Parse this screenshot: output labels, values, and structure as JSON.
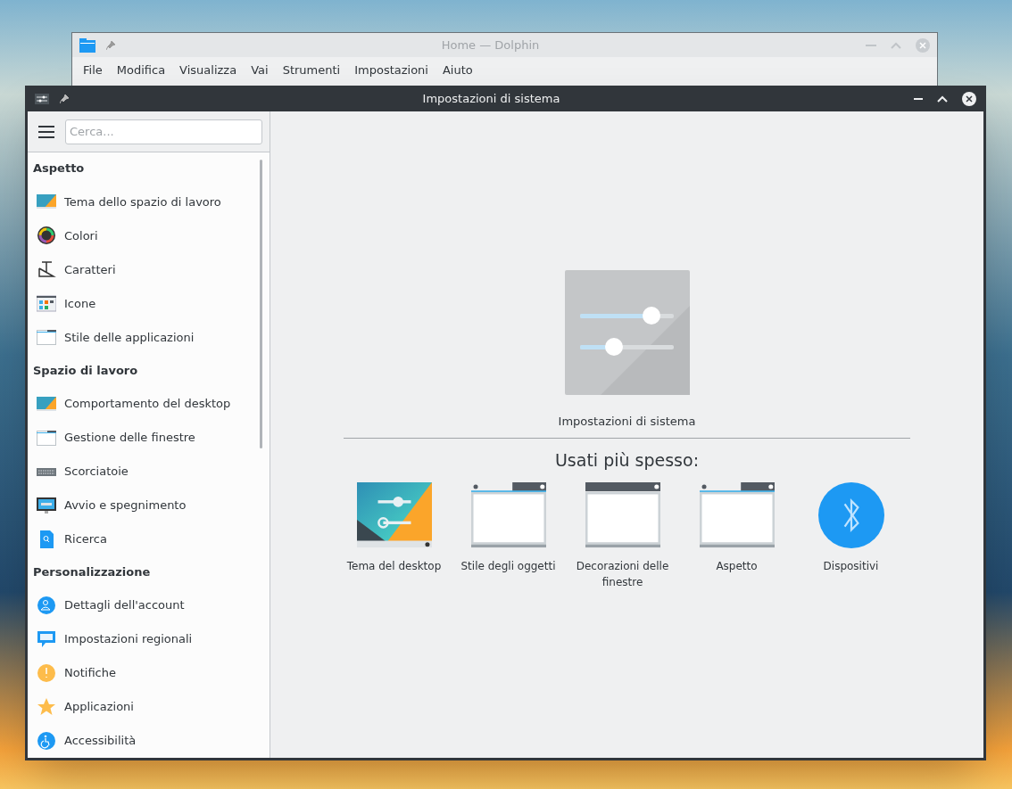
{
  "back_window": {
    "title": "Home — Dolphin",
    "menu": [
      "File",
      "Modifica",
      "Visualizza",
      "Vai",
      "Strumenti",
      "Impostazioni",
      "Aiuto"
    ]
  },
  "window": {
    "title": "Impostazioni di sistema"
  },
  "search": {
    "placeholder": "Cerca..."
  },
  "sidebar": [
    {
      "title": "Aspetto",
      "items": [
        {
          "label": "Tema dello spazio di lavoro",
          "kind": "theme"
        },
        {
          "label": "Colori",
          "kind": "colors"
        },
        {
          "label": "Caratteri",
          "kind": "fonts"
        },
        {
          "label": "Icone",
          "kind": "icons"
        },
        {
          "label": "Stile delle applicazioni",
          "kind": "window"
        }
      ]
    },
    {
      "title": "Spazio di lavoro",
      "items": [
        {
          "label": "Comportamento del desktop",
          "kind": "theme"
        },
        {
          "label": "Gestione delle finestre",
          "kind": "window"
        },
        {
          "label": "Scorciatoie",
          "kind": "keyboard"
        },
        {
          "label": "Avvio e spegnimento",
          "kind": "monitor"
        },
        {
          "label": "Ricerca",
          "kind": "search"
        }
      ]
    },
    {
      "title": "Personalizzazione",
      "items": [
        {
          "label": "Dettagli dell'account",
          "kind": "user"
        },
        {
          "label": "Impostazioni regionali",
          "kind": "chat"
        },
        {
          "label": "Notifiche",
          "kind": "warning"
        },
        {
          "label": "Applicazioni",
          "kind": "star"
        },
        {
          "label": "Accessibilità",
          "kind": "accessibility"
        }
      ]
    }
  ],
  "main": {
    "caption": "Impostazioni di sistema",
    "heading": "Usati più spesso:",
    "most_used": [
      {
        "label": "Tema del desktop",
        "kind": "theme"
      },
      {
        "label": "Stile degli oggetti",
        "kind": "window"
      },
      {
        "label": "Decorazioni delle finestre",
        "kind": "window-dark"
      },
      {
        "label": "Aspetto",
        "kind": "window"
      },
      {
        "label": "Dispositivi",
        "kind": "bluetooth"
      }
    ]
  }
}
